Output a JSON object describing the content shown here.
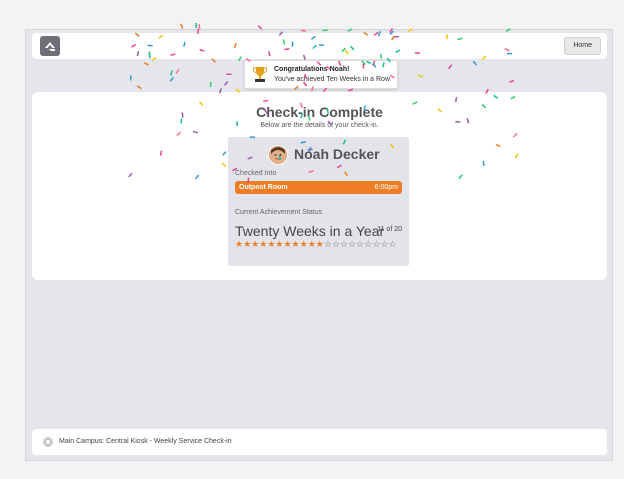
{
  "header": {
    "logo_icon": "rock-logo-icon",
    "home_label": "Home"
  },
  "notification": {
    "title": "Congratulations Noah!",
    "message": "You've achieved Ten Weeks in a Row",
    "icon": "trophy-icon"
  },
  "checkin": {
    "title": "Check-in Complete",
    "subtitle": "Below are the details of your check-in.",
    "person_name": "Noah Decker",
    "checked_into_label": "Checked Into",
    "room": "Outpost Room",
    "time": "6:00pm",
    "achievement_label": "Current Achievement Status",
    "achievement_name": "Twenty Weeks in a Year",
    "achievement_count": "11 of 20",
    "stars_earned": 11,
    "stars_total": 20
  },
  "footer": {
    "icon": "gear-icon",
    "text": "Main Campus: Central Kiosk - Weekly Service Check-in"
  },
  "colors": {
    "accent": "#ee7d26",
    "background": "#e5e6ec"
  }
}
